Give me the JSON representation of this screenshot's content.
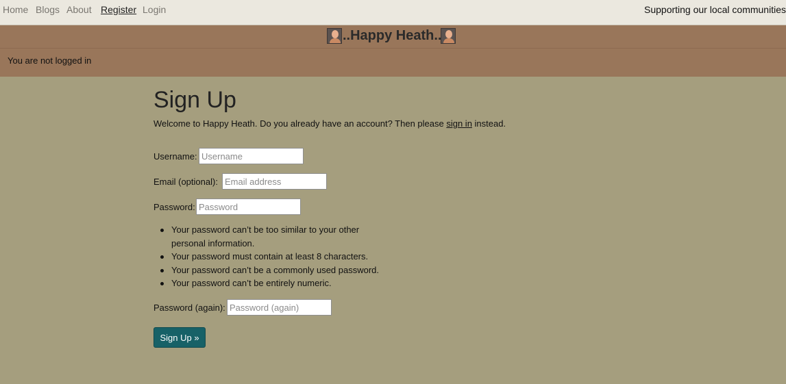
{
  "nav": {
    "links": [
      "Home",
      "Blogs",
      "About",
      "Register",
      "Login"
    ],
    "tagline": "Supporting our local communities"
  },
  "banner": {
    "title": "..Happy Heath..",
    "status": "You are not logged in"
  },
  "signup": {
    "title": "Sign Up",
    "intro_before": "Welcome to Happy Heath. Do you already have an account? Then please ",
    "intro_link": "sign in",
    "intro_after": " instead.",
    "username_label": "Username:",
    "username_placeholder": "Username",
    "email_label": "Email (optional):",
    "email_placeholder": "Email address",
    "password_label": "Password:",
    "password_placeholder": "Password",
    "password_help": [
      "Your password can’t be too similar to your other personal information.",
      "Your password must contain at least 8 characters.",
      "Your password can’t be a commonly used password.",
      "Your password can’t be entirely numeric."
    ],
    "password2_label": "Password (again):",
    "password2_placeholder": "Password (again)",
    "submit_label": "Sign Up »"
  },
  "colors": {
    "page_bg": "#a59e7e",
    "topbar_bg": "#ebe8df",
    "banner_bg": "#99765a",
    "button_bg": "#176167"
  },
  "icons": {
    "banner_left": "avatar-icon",
    "banner_right": "avatar-icon"
  }
}
